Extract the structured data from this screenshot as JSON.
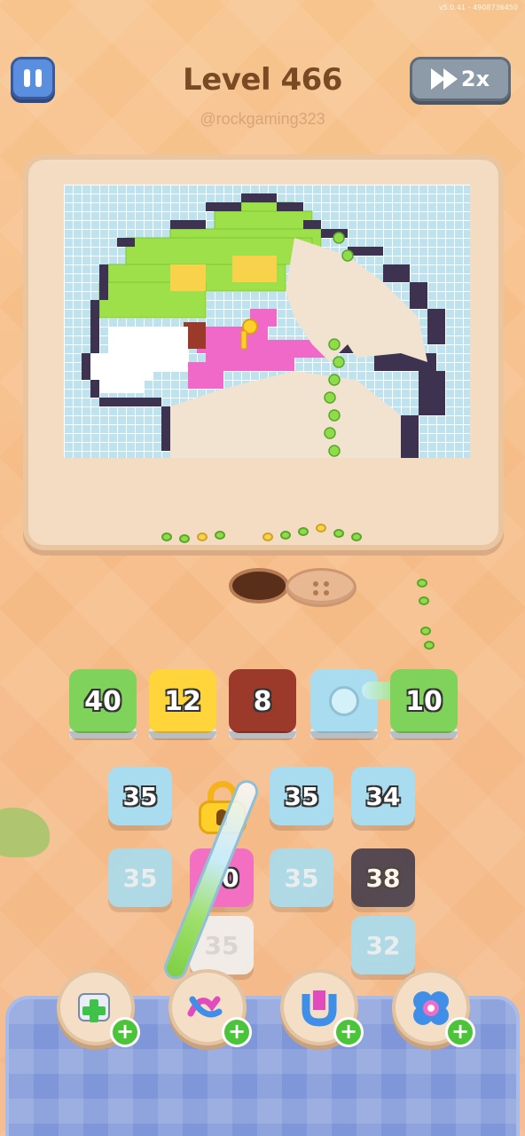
{
  "version": "v5.0.41 - 4908736450",
  "header": {
    "level_title": "Level 466",
    "watermark": "@rockgaming323",
    "speed_label": "2x"
  },
  "slots": [
    {
      "value": "40",
      "color": "#7fd35a"
    },
    {
      "value": "12",
      "color": "#ffd53b"
    },
    {
      "value": "8",
      "color": "#9b3a2a"
    },
    {
      "value": "",
      "color": "#a8dcee"
    },
    {
      "value": "10",
      "color": "#7fd35a"
    }
  ],
  "tiles": [
    {
      "value": "35",
      "color": "#a8dcee"
    },
    {
      "value": "35",
      "color": "#a8dcee"
    },
    {
      "value": "34",
      "color": "#a8dcee"
    },
    {
      "value": "35",
      "color": "#a8dcee"
    },
    {
      "value": "30",
      "color": "#f26fc2"
    },
    {
      "value": "35",
      "color": "#a8dcee"
    },
    {
      "value": "38",
      "color": "#3b3548"
    },
    {
      "value": "35",
      "color": "#f1f1f1"
    },
    {
      "value": "32",
      "color": "#a8dcee"
    }
  ],
  "boosters": [
    {
      "icon": "add-box-icon"
    },
    {
      "icon": "shuffle-arrows-icon"
    },
    {
      "icon": "magnet-icon"
    },
    {
      "icon": "flower-icon"
    }
  ],
  "colors": {
    "pixel_green": "#9ee04a",
    "pixel_yellow": "#f7d24a",
    "pixel_pink": "#f069c8",
    "pixel_dark": "#3d3350",
    "pixel_white": "#ffffff",
    "pixel_brown": "#9b3a2a"
  }
}
